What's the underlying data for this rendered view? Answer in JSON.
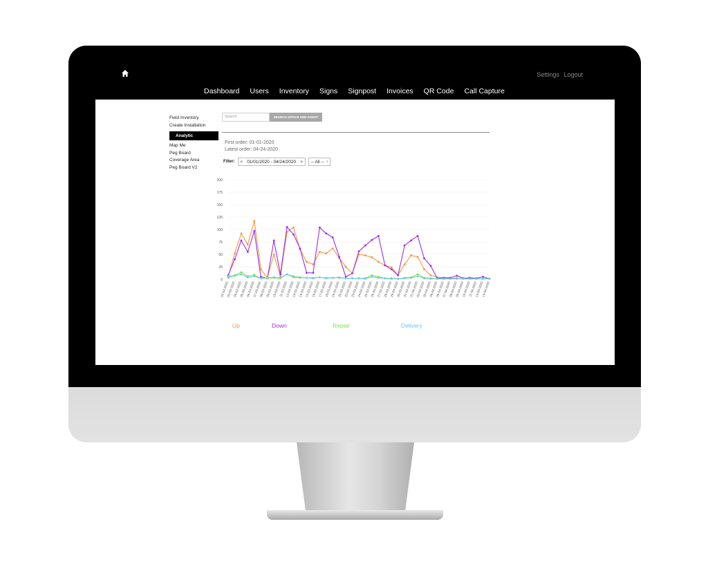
{
  "top_links": {
    "settings": "Settings",
    "logout": "Logout"
  },
  "nav": [
    "Dashboard",
    "Users",
    "Inventory",
    "Signs",
    "Signpost",
    "Invoices",
    "QR Code",
    "Call Capture"
  ],
  "sidebar": {
    "items": [
      "Field Inventory",
      "Create Installation",
      "Analytic",
      "Map Me",
      "Peg Board",
      "Coverage Area",
      "Peg Board V2"
    ],
    "active": "Analytic"
  },
  "search": {
    "placeholder": "Search",
    "button": "SEARCH OFFICE AND AGENT"
  },
  "orders": {
    "first": "First order: 01-01-2020",
    "latest": "Latest order: 04-24-2020"
  },
  "filter": {
    "label": "Filter:",
    "date_range": "01/01/2020 - 04/24/2020",
    "select_value": "-- All --"
  },
  "colors": {
    "up": "#f7953a",
    "down": "#9b2cf0",
    "repair": "#7be447",
    "delivery": "#6cc7f0"
  },
  "chart_data": {
    "type": "line",
    "ylim": [
      0,
      200
    ],
    "y_ticks": [
      0,
      25,
      50,
      75,
      100,
      125,
      150,
      175,
      200
    ],
    "x": [
      "02-03-2020",
      "03-03-2020",
      "04-03-2020",
      "05-03-2020",
      "06-03-2020",
      "07-03-2020",
      "08-03-2020",
      "09-03-2020",
      "10-03-2020",
      "11-03-2020",
      "12-03-2020",
      "13-03-2020",
      "14-03-2020",
      "15-03-2020",
      "16-03-2020",
      "17-03-2020",
      "18-03-2020",
      "19-03-2020",
      "20-03-2020",
      "22-03-2020",
      "23-03-2020",
      "24-03-2020",
      "25-03-2020",
      "26-03-2020",
      "27-03-2020",
      "28-03-2020",
      "29-03-2020",
      "30-03-2020",
      "31-03-2020",
      "01-04-2020",
      "02-04-2020",
      "03-04-2020",
      "04-04-2020",
      "06-04-2020",
      "07-04-2020",
      "08-04-2020",
      "09-04-2020",
      "10-04-2020",
      "11-04-2020",
      "13-04-2020",
      "14-04-2020"
    ],
    "series": [
      {
        "name": "Up",
        "values": [
          5,
          52,
          92,
          70,
          117,
          20,
          3,
          50,
          5,
          95,
          104,
          60,
          35,
          30,
          55,
          52,
          62,
          43,
          25,
          12,
          50,
          48,
          44,
          35,
          28,
          24,
          8,
          30,
          48,
          45,
          20,
          8,
          4,
          3,
          2,
          2,
          1,
          1,
          1,
          1,
          1
        ]
      },
      {
        "name": "Down",
        "values": [
          8,
          40,
          78,
          55,
          97,
          5,
          2,
          78,
          10,
          105,
          90,
          62,
          13,
          13,
          104,
          92,
          84,
          45,
          5,
          12,
          56,
          68,
          79,
          87,
          28,
          20,
          8,
          68,
          78,
          87,
          42,
          27,
          2,
          3,
          3,
          7,
          2,
          3,
          2,
          5,
          1
        ]
      },
      {
        "name": "Repair",
        "values": [
          3,
          8,
          14,
          6,
          9,
          2,
          2,
          3,
          2,
          10,
          6,
          4,
          3,
          3,
          4,
          3,
          3,
          4,
          2,
          2,
          2,
          2,
          8,
          5,
          2,
          2,
          1,
          3,
          4,
          10,
          3,
          2,
          1,
          1,
          1,
          1,
          1,
          1,
          1,
          1,
          1
        ]
      },
      {
        "name": "Delivery",
        "values": [
          6,
          7,
          10,
          4,
          6,
          2,
          3,
          4,
          3,
          10,
          4,
          3,
          3,
          2,
          4,
          2,
          3,
          3,
          2,
          2,
          2,
          1,
          5,
          3,
          2,
          1,
          1,
          2,
          3,
          6,
          2,
          1,
          1,
          1,
          1,
          1,
          1,
          1,
          1,
          1,
          1
        ]
      }
    ]
  }
}
